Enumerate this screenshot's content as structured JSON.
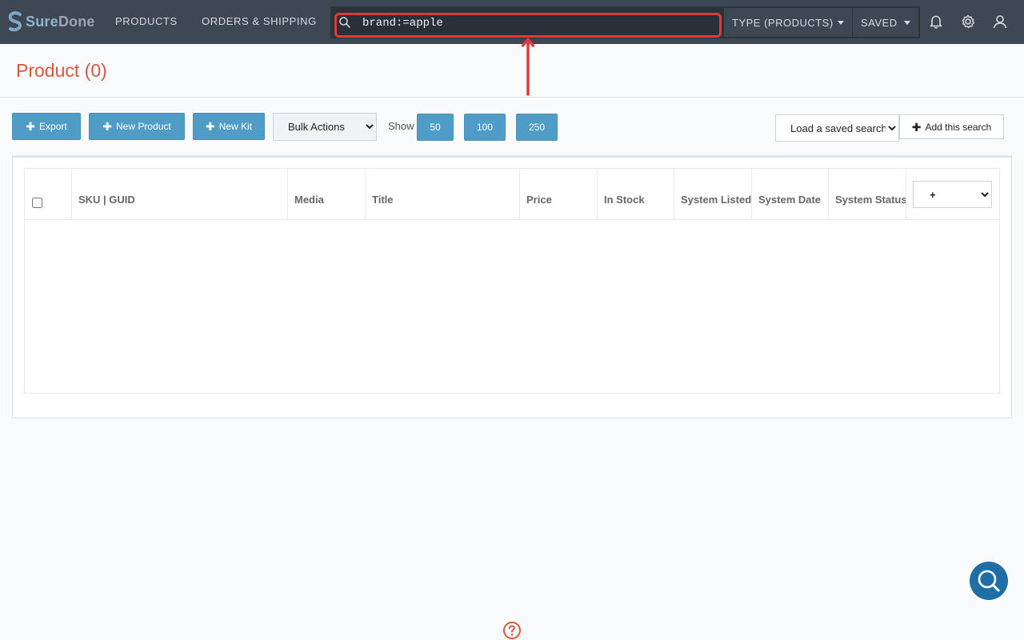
{
  "app": {
    "logo_text_sure": "Sure",
    "logo_text_done": "Done"
  },
  "nav": {
    "items": [
      {
        "label": "PRODUCTS"
      },
      {
        "label": "ORDERS & SHIPPING"
      }
    ],
    "search": {
      "value": "brand:=apple",
      "placeholder": ""
    },
    "type_dropdown": {
      "label": "TYPE (PRODUCTS)"
    },
    "saved_dropdown": {
      "label": "SAVED"
    },
    "icons": [
      "bell-icon",
      "gear-icon",
      "user-icon"
    ]
  },
  "page": {
    "title": "Product (0)"
  },
  "toolbar": {
    "export_label": "Export",
    "new_product_label": "New Product",
    "new_kit_label": "New Kit",
    "bulk_actions": {
      "selected": "Bulk Actions"
    },
    "show_label": "Show",
    "page_sizes": [
      "50",
      "100",
      "250"
    ],
    "saved_search": {
      "selected": "Load a saved search"
    },
    "add_search_label": "Add this search"
  },
  "table": {
    "columns": [
      "SKU | GUID",
      "Media",
      "Title",
      "Price",
      "In Stock",
      "System Listed",
      "System Date",
      "System Status"
    ],
    "column_select": {
      "selected": "+"
    },
    "rows": []
  },
  "colors": {
    "nav_bg": "#3e4754",
    "accent_blue": "#4f9dc7",
    "title_orange": "#d9573e",
    "highlight_red": "#e23a3a"
  }
}
